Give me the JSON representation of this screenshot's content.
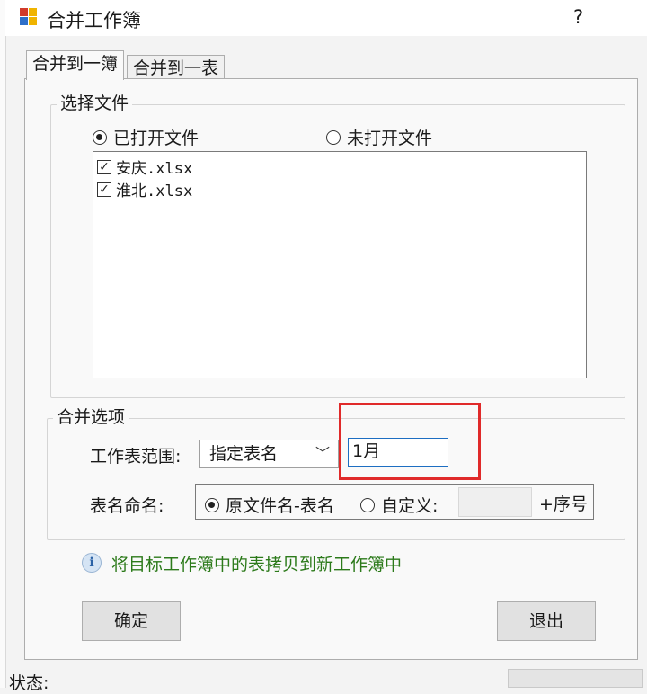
{
  "window": {
    "title": "合并工作簿",
    "help": "?"
  },
  "tabs": [
    {
      "label": "合并到一簿",
      "active": true
    },
    {
      "label": "合并到一表",
      "active": false
    }
  ],
  "select_files": {
    "group_label": "选择文件",
    "radio_opened": {
      "label": "已打开文件",
      "checked": true
    },
    "radio_unopened": {
      "label": "未打开文件",
      "checked": false
    },
    "files": [
      {
        "name": "安庆.xlsx",
        "checked": true
      },
      {
        "name": "淮北.xlsx",
        "checked": true
      }
    ]
  },
  "merge_options": {
    "group_label": "合并选项",
    "sheet_range_label": "工作表范围:",
    "sheet_range_value": "指定表名",
    "sheet_name_value": "1月",
    "naming_label": "表名命名:",
    "naming_original": {
      "label": "原文件名-表名",
      "checked": true
    },
    "naming_custom": {
      "label": "自定义:",
      "checked": false
    },
    "serial_label": "+序号"
  },
  "info": {
    "icon": "info-icon",
    "text": "将目标工作簿中的表拷贝到新工作簿中"
  },
  "buttons": {
    "confirm": "确定",
    "exit": "退出"
  },
  "status": {
    "label": "状态:"
  },
  "colors": {
    "highlight": "#e02a2a",
    "info_text": "#2c7a1a",
    "focus_border": "#1d6ec2"
  }
}
